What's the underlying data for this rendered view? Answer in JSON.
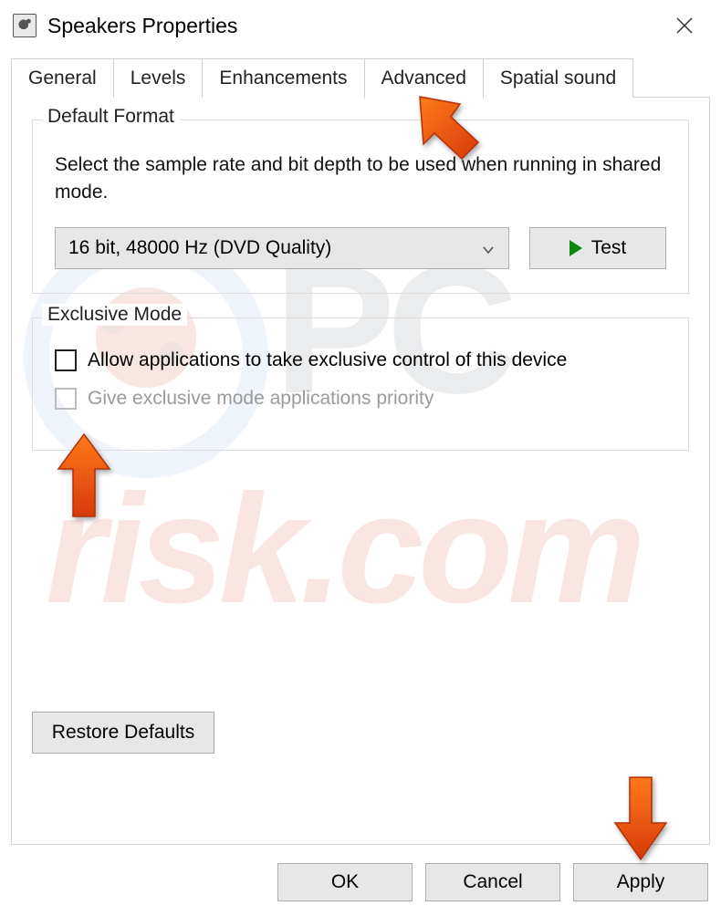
{
  "title": "Speakers Properties",
  "tabs": [
    "General",
    "Levels",
    "Enhancements",
    "Advanced",
    "Spatial sound"
  ],
  "active_tab": "Advanced",
  "default_format": {
    "group_title": "Default Format",
    "description": "Select the sample rate and bit depth to be used when running in shared mode.",
    "selected": "16 bit, 48000 Hz (DVD Quality)",
    "test_label": "Test"
  },
  "exclusive_mode": {
    "group_title": "Exclusive Mode",
    "allow_label": "Allow applications to take exclusive control of this device",
    "allow_checked": false,
    "priority_label": "Give exclusive mode applications priority",
    "priority_enabled": false
  },
  "restore_label": "Restore Defaults",
  "buttons": {
    "ok": "OK",
    "cancel": "Cancel",
    "apply": "Apply"
  }
}
